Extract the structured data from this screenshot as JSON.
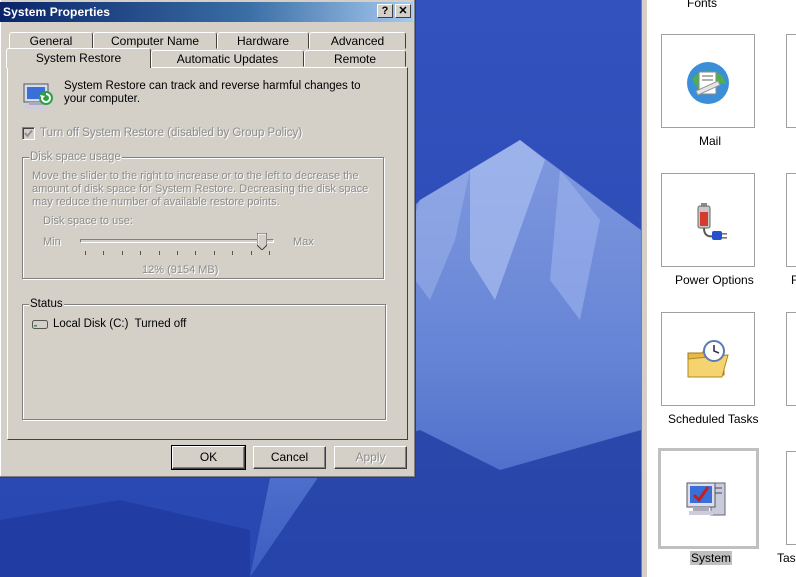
{
  "dialog": {
    "title": "System Properties",
    "help_glyph": "?",
    "close_glyph": "✕",
    "tabs_back": [
      "General",
      "Computer Name",
      "Hardware",
      "Advanced"
    ],
    "tabs_front": [
      "System Restore",
      "Automatic Updates",
      "Remote"
    ],
    "active_tab": "System Restore",
    "intro": "System Restore can track and reverse harmful changes to your computer.",
    "checkbox_label": "Turn off System Restore (disabled by Group Policy)",
    "disk_group": {
      "legend": "Disk space usage",
      "description": "Move the slider to the right to increase or to the left to decrease the amount of disk space for System Restore. Decreasing the disk space may reduce the number of available restore points.",
      "slider_caption": "Disk space to use:",
      "min_label": "Min",
      "max_label": "Max",
      "value_text": "12% (9154 MB)",
      "slider_fraction": 0.96
    },
    "status_group": {
      "legend": "Status",
      "drive_name": "Local Disk (C:)",
      "drive_state": "Turned off"
    },
    "buttons": {
      "ok": "OK",
      "cancel": "Cancel",
      "apply": "Apply"
    }
  },
  "control_panel": {
    "items": [
      {
        "label": "Fonts",
        "icon": "fonts-icon"
      },
      {
        "label": "Mail",
        "icon": "mail-icon"
      },
      {
        "label": "Power Options",
        "icon": "power-options-icon"
      },
      {
        "label": "Scheduled Tasks",
        "icon": "scheduled-tasks-icon"
      },
      {
        "label": "System",
        "icon": "system-icon",
        "selected": true
      }
    ],
    "partial_labels": [
      "F",
      "Tas"
    ]
  }
}
